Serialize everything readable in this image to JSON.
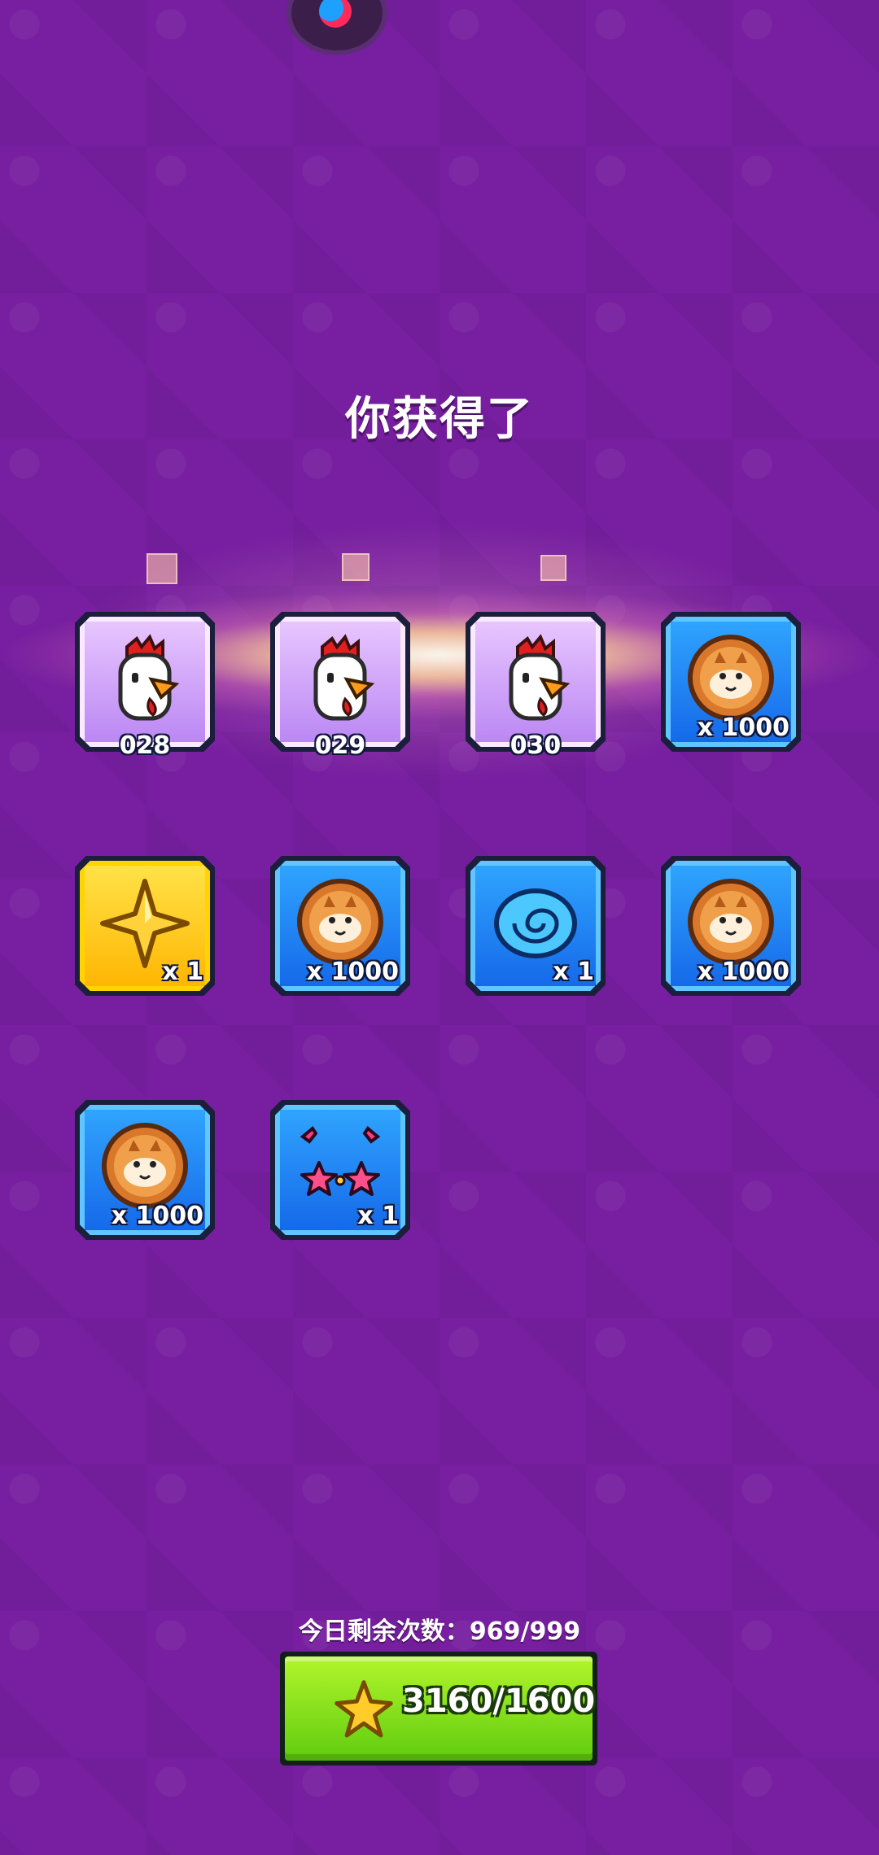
{
  "screen": {
    "title": "你获得了"
  },
  "rewards": [
    {
      "type": "chicken",
      "frame": "purple",
      "label": "028"
    },
    {
      "type": "chicken",
      "frame": "purple",
      "label": "029"
    },
    {
      "type": "chicken",
      "frame": "purple",
      "label": "030"
    },
    {
      "type": "coin",
      "frame": "blue",
      "label": "x 1000"
    },
    {
      "type": "star",
      "frame": "gold",
      "label": "x 1"
    },
    {
      "type": "coin",
      "frame": "blue",
      "label": "x 1000"
    },
    {
      "type": "shell",
      "frame": "blue",
      "label": "x 1"
    },
    {
      "type": "coin",
      "frame": "blue",
      "label": "x 1000"
    },
    {
      "type": "coin",
      "frame": "blue",
      "label": "x 1000"
    },
    {
      "type": "sunglasses",
      "frame": "blue",
      "label": "x 1"
    }
  ],
  "footer": {
    "remaining_label": "今日剩余次数：969/999",
    "draw_button_label": "3160/1600"
  },
  "icons": {
    "top": "app-avatar-icon",
    "button": "gold-star-icon"
  },
  "colors": {
    "background": "#771fa0",
    "button_green": "#8ee81e",
    "tile_blue": "#1f86ff",
    "tile_purple": "#d2a6ff",
    "tile_gold": "#ffcc00"
  }
}
